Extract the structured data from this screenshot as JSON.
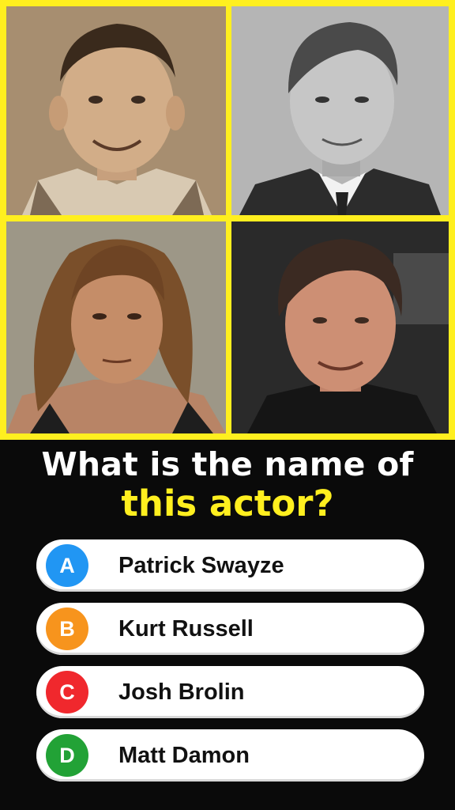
{
  "question": {
    "line1": "What is the name of",
    "line2": "this actor?"
  },
  "colors": {
    "accent": "#ffef1f",
    "background": "#0a0a0a",
    "badge_a": "#2196f3",
    "badge_b": "#f7941d",
    "badge_c": "#f0282d",
    "badge_d": "#22a236"
  },
  "answers": [
    {
      "letter": "A",
      "text": "Patrick Swayze"
    },
    {
      "letter": "B",
      "text": "Kurt Russell"
    },
    {
      "letter": "C",
      "text": "Josh Brolin"
    },
    {
      "letter": "D",
      "text": "Matt Damon"
    }
  ]
}
